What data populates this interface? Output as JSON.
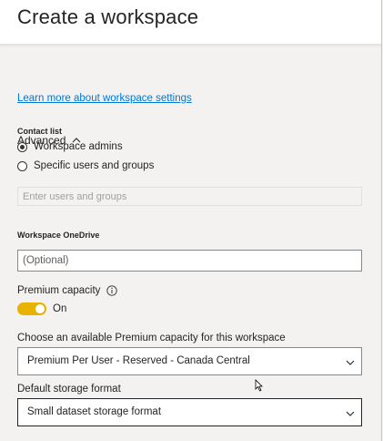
{
  "header": {
    "title": "Create a workspace"
  },
  "links": {
    "learn_more": "Learn more about workspace settings"
  },
  "advanced": {
    "label": "Advanced",
    "icon": "chevron-up-icon"
  },
  "contact_list": {
    "label": "Contact list",
    "options": [
      {
        "label": "Workspace admins",
        "selected": true
      },
      {
        "label": "Specific users and groups",
        "selected": false
      }
    ],
    "input_placeholder": "Enter users and groups"
  },
  "onedrive": {
    "label": "Workspace OneDrive",
    "placeholder": "(Optional)"
  },
  "premium": {
    "label": "Premium capacity",
    "info_icon": "info-icon",
    "toggle_label": "On",
    "toggle_on": true,
    "toggle_color": "#e8b200"
  },
  "capacity": {
    "label": "Choose an available Premium capacity for this workspace",
    "value": "Premium Per User - Reserved - Canada Central"
  },
  "storage": {
    "label": "Default storage format",
    "value": "Small dataset storage format"
  },
  "colors": {
    "link": "#0078d4",
    "text": "#252423",
    "panel": "#f3f2f1"
  }
}
